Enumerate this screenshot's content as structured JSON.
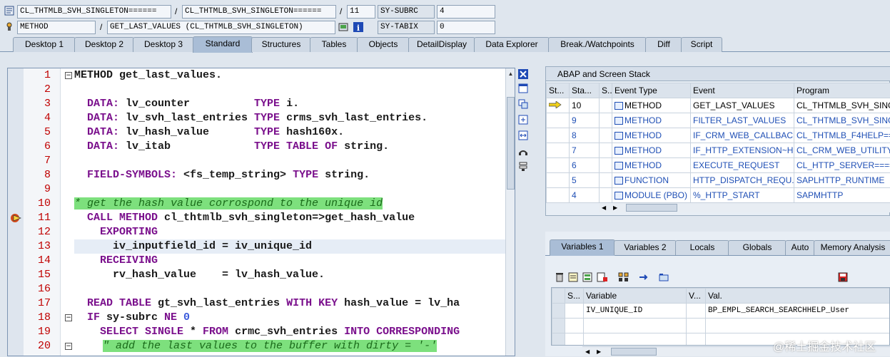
{
  "header": {
    "row1": {
      "program": "CL_THTMLB_SVH_SINGLETON======",
      "include": "CL_THTMLB_SVH_SINGLETON======",
      "line": "11",
      "sy_field": "SY-SUBRC",
      "sy_value": "4",
      "sep1": "/",
      "sep2": "/"
    },
    "row2": {
      "type": "METHOD",
      "name": "GET_LAST_VALUES (CL_THTMLB_SVH_SINGLETON)",
      "sy_field": "SY-TABIX",
      "sy_value": "0",
      "sep": "/"
    }
  },
  "tabs": [
    "Desktop 1",
    "Desktop 2",
    "Desktop 3",
    "Standard",
    "Structures",
    "Tables",
    "Objects",
    "DetailDisplay",
    "Data Explorer",
    "Break./Watchpoints",
    "Diff",
    "Script"
  ],
  "active_tab": "Standard",
  "code": {
    "line_numbers": [
      "1",
      "2",
      "3",
      "4",
      "5",
      "6",
      "7",
      "8",
      "9",
      "10",
      "11",
      "12",
      "13",
      "14",
      "15",
      "16",
      "17",
      "18",
      "19",
      "20"
    ],
    "l1a": "METHOD",
    "l1b": " get_last_values.",
    "l3a": "  DATA:",
    "l3b": " lv_counter          ",
    "l3c": "TYPE",
    "l3d": " i.",
    "l4a": "  DATA:",
    "l4b": " lv_svh_last_entries ",
    "l4c": "TYPE",
    "l4d": " crms_svh_last_entries.",
    "l5a": "  DATA:",
    "l5b": " lv_hash_value       ",
    "l5c": "TYPE",
    "l5d": " hash160x.",
    "l6a": "  DATA:",
    "l6b": " lv_itab             ",
    "l6c": "TYPE TABLE OF",
    "l6d": " string.",
    "l8a": "  FIELD-SYMBOLS:",
    "l8b": " <fs_temp_string> ",
    "l8c": "TYPE",
    "l8d": " string.",
    "l10": "* get the hash value corrospond to the unique id",
    "l11a": "  CALL METHOD",
    "l11b": " cl_thtmlb_svh_singleton=>get_hash_value",
    "l12": "    EXPORTING",
    "l13": "      iv_inputfield_id = iv_unique_id",
    "l14": "    RECEIVING",
    "l15": "      rv_hash_value    = lv_hash_value.",
    "l17a": "  READ TABLE",
    "l17b": " gt_svh_last_entries ",
    "l17c": "WITH KEY",
    "l17d": " hash_value = lv_ha",
    "l18a": "  IF",
    "l18b": " sy-subrc ",
    "l18c": "NE",
    "l18d": " 0",
    ".": ".",
    "l19a": "    SELECT SINGLE",
    "l19b": " * ",
    "l19c": "FROM",
    "l19d": " crmc_svh_entries ",
    "l19e": "INTO CORRESPONDING",
    "l20": "\" add the last values to the buffer with dirty = '-'"
  },
  "stack": {
    "title": "ABAP and Screen Stack",
    "columns": [
      "St...",
      "Sta...",
      "S...",
      "Event Type",
      "Event",
      "Program"
    ],
    "rows": [
      {
        "stack": "10",
        "type": "METHOD",
        "event": "GET_LAST_VALUES",
        "program": "CL_THTMLB_SVH_SINGL"
      },
      {
        "stack": "9",
        "type": "METHOD",
        "event": "FILTER_LAST_VALUES",
        "program": "CL_THTMLB_SVH_SINGL"
      },
      {
        "stack": "8",
        "type": "METHOD",
        "event": "IF_CRM_WEB_CALLBACK...",
        "program": "CL_THTMLB_F4HELP=="
      },
      {
        "stack": "7",
        "type": "METHOD",
        "event": "IF_HTTP_EXTENSION~H...",
        "program": "CL_CRM_WEB_UTILITY="
      },
      {
        "stack": "6",
        "type": "METHOD",
        "event": "EXECUTE_REQUEST",
        "program": "CL_HTTP_SERVER===="
      },
      {
        "stack": "5",
        "type": "FUNCTION",
        "event": "HTTP_DISPATCH_REQU...",
        "program": "SAPLHTTP_RUNTIME"
      },
      {
        "stack": "4",
        "type": "MODULE (PBO)",
        "event": "%_HTTP_START",
        "program": "SAPMHTTP"
      }
    ]
  },
  "vars": {
    "tabs": [
      "Variables 1",
      "Variables 2",
      "Locals",
      "Globals",
      "Auto",
      "Memory Analysis"
    ],
    "active_tab": "Variables 1",
    "columns": [
      "S...",
      "Variable",
      "V...",
      "Val."
    ],
    "rows": [
      {
        "variable": "IV_UNIQUE_ID",
        "value": "BP_EMPL_SEARCH_SEARCHHELP_User"
      }
    ]
  },
  "watermark": "@稀土掘金技术社区"
}
